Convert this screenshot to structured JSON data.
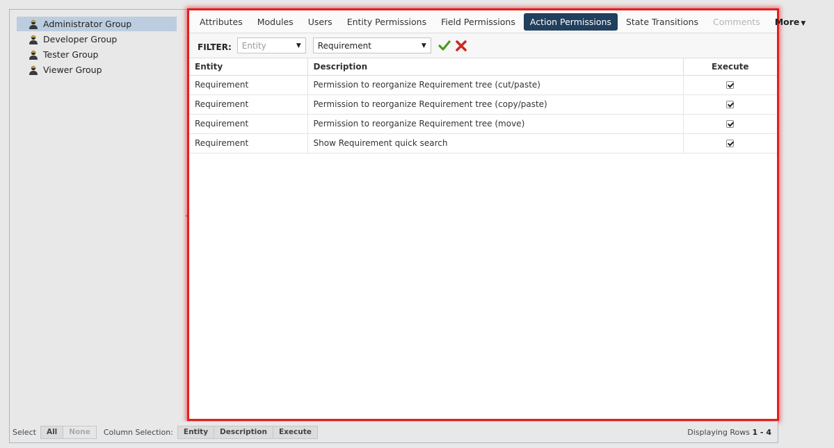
{
  "tree": {
    "groups": [
      {
        "label": "Administrator Group",
        "selected": true
      },
      {
        "label": "Developer Group",
        "selected": false
      },
      {
        "label": "Tester Group",
        "selected": false
      },
      {
        "label": "Viewer Group",
        "selected": false
      }
    ]
  },
  "tabs": [
    {
      "label": "Attributes",
      "state": "normal"
    },
    {
      "label": "Modules",
      "state": "normal"
    },
    {
      "label": "Users",
      "state": "normal"
    },
    {
      "label": "Entity Permissions",
      "state": "normal"
    },
    {
      "label": "Field Permissions",
      "state": "normal"
    },
    {
      "label": "Action Permissions",
      "state": "active"
    },
    {
      "label": "State Transitions",
      "state": "normal"
    },
    {
      "label": "Comments",
      "state": "disabled"
    }
  ],
  "more_tab": {
    "label": "More",
    "icon": "caret-down-icon"
  },
  "filter": {
    "label": "FILTER:",
    "entity_placeholder": "Entity",
    "entity_value": "Requirement"
  },
  "grid": {
    "columns": [
      "Entity",
      "Description",
      "Execute"
    ],
    "rows": [
      {
        "entity": "Requirement",
        "description": "Permission to reorganize Requirement tree (cut/paste)",
        "execute": true
      },
      {
        "entity": "Requirement",
        "description": "Permission to reorganize Requirement tree (copy/paste)",
        "execute": true
      },
      {
        "entity": "Requirement",
        "description": "Permission to reorganize Requirement tree (move)",
        "execute": true
      },
      {
        "entity": "Requirement",
        "description": "Show Requirement quick search",
        "execute": true
      }
    ]
  },
  "bottom": {
    "select_label": "Select",
    "all_label": "All",
    "none_label": "None",
    "column_selection_label": "Column Selection:",
    "column_buttons": [
      "Entity",
      "Description",
      "Execute"
    ],
    "rows_prefix": "Displaying Rows",
    "rows_range": "1 - 4"
  },
  "colors": {
    "active_tab": "#213f5e",
    "selected_tree": "#bccde0",
    "highlight_border": "#e02020",
    "ok_green": "#4a9a1a",
    "cancel_red": "#d0281e"
  }
}
